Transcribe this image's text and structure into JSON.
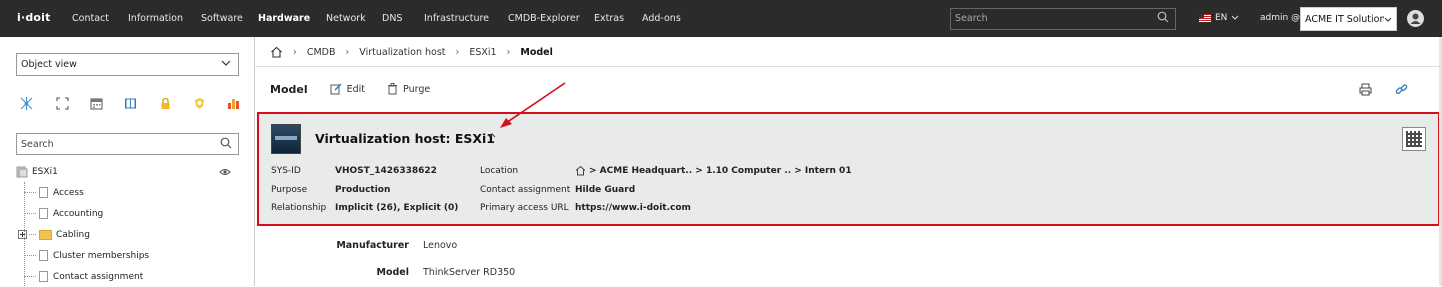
{
  "topbar": {
    "logo": "i·doit",
    "nav": [
      "Contact",
      "Information",
      "Software",
      "Hardware",
      "Network",
      "DNS",
      "Infrastructure",
      "CMDB-Explorer",
      "Extras",
      "Add-ons"
    ],
    "active_nav": "Hardware",
    "search_placeholder": "Search",
    "language": "EN",
    "user": "admin @",
    "tenant": "ACME IT Solution"
  },
  "sidebar": {
    "view_select": "Object view",
    "toolbar_icons": [
      "relations-icon",
      "expand-icon",
      "calendar-icon",
      "book-icon",
      "lock-icon",
      "badge-icon",
      "bar-chart-icon"
    ],
    "search_placeholder": "Search",
    "tree": {
      "root": "ESXi1",
      "items": [
        "Access",
        "Accounting",
        "Cabling",
        "Cluster memberships",
        "Contact assignment"
      ]
    }
  },
  "breadcrumb": {
    "items": [
      "CMDB",
      "Virtualization host",
      "ESXi1"
    ],
    "current": "Model"
  },
  "toolbar": {
    "title": "Model",
    "edit_label": "Edit",
    "purge_label": "Purge"
  },
  "header_panel": {
    "title": "Virtualization host: ESXi1",
    "sysid_label": "SYS-ID",
    "sysid_value": "VHOST_1426338622",
    "purpose_label": "Purpose",
    "purpose_value": "Production",
    "relationship_label": "Relationship",
    "relationship_value": "Implicit (26), Explicit (0)",
    "location_label": "Location",
    "location_value": "> ACME Headquart.. > 1.10 Computer .. > Intern 01",
    "contact_label": "Contact assignment",
    "contact_value": "Hilde Guard",
    "url_label": "Primary access URL",
    "url_value": "https://www.i-doit.com"
  },
  "details": {
    "manufacturer_label": "Manufacturer",
    "manufacturer_value": "Lenovo",
    "model_label": "Model",
    "model_value": "ThinkServer RD350"
  },
  "colors": {
    "topbar": "#2b2b2b",
    "panel_bg": "#e9eaea",
    "highlight_border": "#d40f1a",
    "folder": "#f2c34d"
  }
}
